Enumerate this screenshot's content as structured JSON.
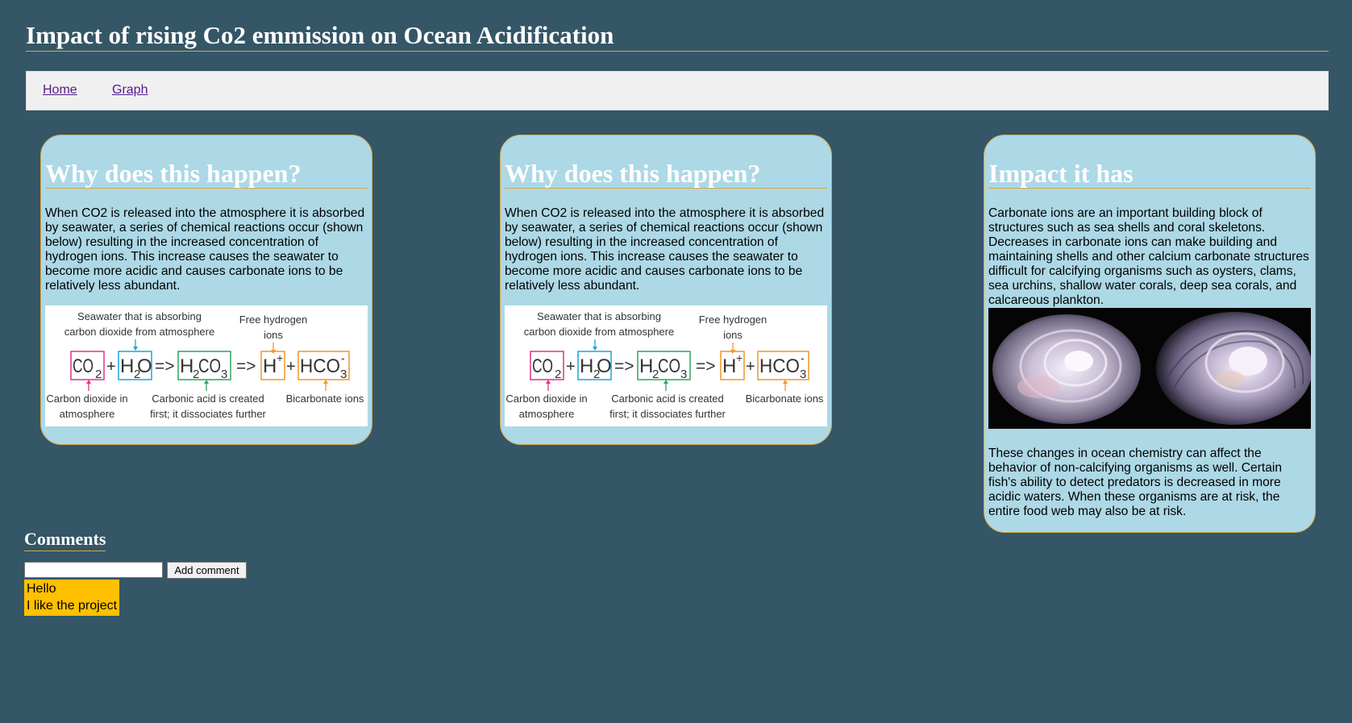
{
  "page": {
    "title": "Impact of rising Co2 emmission on Ocean Acidification",
    "colors": {
      "background": "#345666",
      "card": "#add8e6",
      "accent_border": "#d4a84a",
      "nav": "#f0f0f0",
      "comment_bg": "#ffc000"
    }
  },
  "nav": {
    "items": [
      {
        "label": "Home"
      },
      {
        "label": "Graph"
      }
    ]
  },
  "cards": [
    {
      "title": "Why does this happen?",
      "text": "When CO2 is released into the atmosphere it is absorbed by seawater, a series of chemical reactions occur (shown below) resulting in the increased concentration of hydrogen ions. This increase causes the seawater to become more acidic and causes carbonate ions to be relatively less abundant."
    },
    {
      "title": "Why does this happen?",
      "text": "When CO2 is released into the atmosphere it is absorbed by seawater, a series of chemical reactions occur (shown below) resulting in the increased concentration of hydrogen ions. This increase causes the seawater to become more acidic and causes carbonate ions to be relatively less abundant."
    },
    {
      "title": "Impact it has",
      "text": "Carbonate ions are an important building block of structures such as sea shells and coral skeletons. Decreases in carbonate ions can make building and maintaining shells and other calcium carbonate structures difficult for calcifying organisms such as oysters, clams, sea urchins, shallow water corals, deep sea corals, and calcareous plankton.",
      "text2": "These changes in ocean chemistry can affect the behavior of non-calcifying organisms as well. Certain fish's ability to detect predators is decreased in more acidic waters. When these organisms are at risk, the entire food web may also be at risk."
    }
  ],
  "diagram": {
    "seawater_label_1": "Seawater that is absorbing",
    "seawater_label_2": "carbon dioxide from atmosphere",
    "hydrogen_label_1": "Free hydrogen",
    "hydrogen_label_2": "ions",
    "co2": "CO",
    "co2_sub": "2",
    "h2o_h": "H",
    "h2o_sub": "2",
    "h2o_o": "O",
    "h2co3_h": "H",
    "h2co3_sub1": "2",
    "h2co3_co": "CO",
    "h2co3_sub2": "3",
    "hplus": "H",
    "hplus_sup": "+",
    "hco3": "HCO",
    "hco3_sub": "3",
    "hco3_sup": "-",
    "plus": "+",
    "arrow": "=>",
    "co2_label_1": "Carbon dioxide in",
    "co2_label_2": "atmosphere",
    "acid_label_1": "Carbonic acid is created",
    "acid_label_2": "first; it dissociates further",
    "bicarb_label": "Bicarbonate ions"
  },
  "comments": {
    "title": "Comments",
    "input_value": "",
    "button_label": "Add comment",
    "items": [
      "Hello",
      "I like the project"
    ]
  }
}
